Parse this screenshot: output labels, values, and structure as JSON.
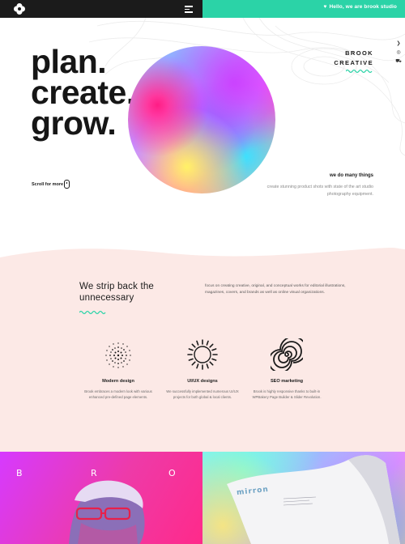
{
  "topbar": {
    "greeting": "Hello, we are brook studio",
    "accent_color": "#2bd3a7",
    "dark_color": "#1b1b1b",
    "logo_icon": "clover-logo-icon",
    "menu_icon": "hamburger-menu-icon"
  },
  "hero": {
    "headline": [
      "plan.",
      "create.",
      "grow."
    ],
    "brand_line1": "BROOK",
    "brand_line2": "CREATIVE",
    "scroll_label": "Scroll for more",
    "tagline": "we do many things",
    "description": "create stunning product shots with state of the art studio photography equipment."
  },
  "side_icons": [
    "twitter-icon",
    "instagram-icon",
    "cart-icon"
  ],
  "intro": {
    "title_line1": "We strip back the",
    "title_line2": "unnecessary",
    "text": "focus on creating creative, original, and conceptual works for editorial illustrations, magazines, covers, and brands as well as online visual organizations."
  },
  "features": [
    {
      "title": "Modern design",
      "description": "Brook embraces a modern look with various enhanced pre-defined page elements.",
      "icon": "dotted-circle-icon"
    },
    {
      "title": "UI/UX designs",
      "description": "We successfully implemented numerous UI/UX projects for both global & local clients.",
      "icon": "ring-burst-icon"
    },
    {
      "title": "SEO marketing",
      "description": "Brook is highly responsive thanks to built-in WPBakery Page Builder & Slider Revolution.",
      "icon": "spiral-icon"
    }
  ],
  "portfolio": {
    "left_letters": [
      "B",
      "R",
      "O"
    ],
    "right_brand": "mirron",
    "left_gradient": [
      "#d63aff",
      "#ff2a8a"
    ],
    "right_gradient": [
      "#7ff0ff",
      "#e58bff"
    ]
  }
}
